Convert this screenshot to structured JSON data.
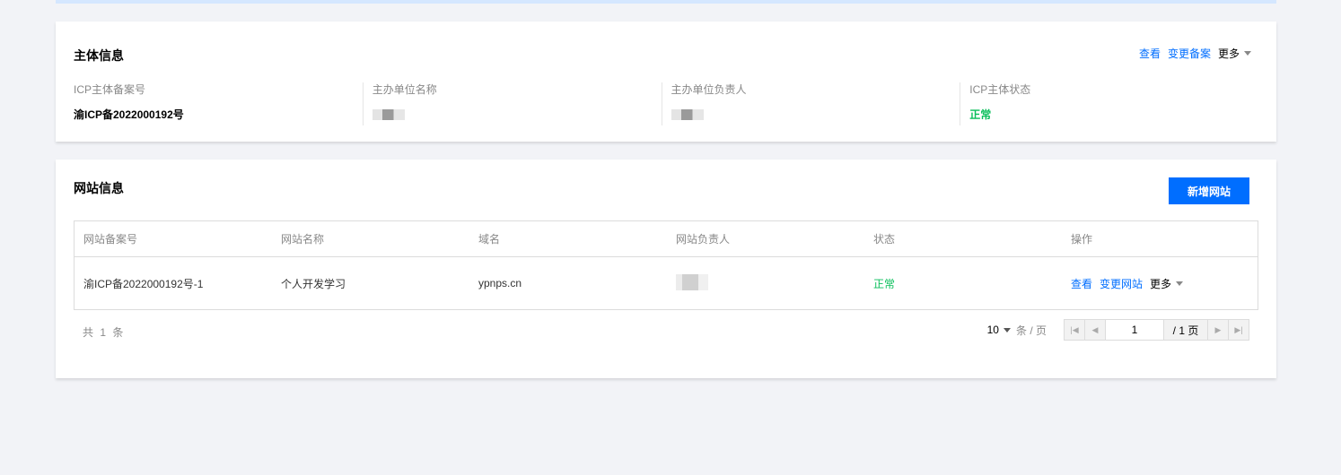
{
  "subject": {
    "title": "主体信息",
    "actions": {
      "view": "查看",
      "change": "变更备案",
      "more": "更多"
    },
    "fields": [
      {
        "label": "ICP主体备案号",
        "value": "渝ICP备2022000192号"
      },
      {
        "label": "主办单位名称",
        "value": ""
      },
      {
        "label": "主办单位负责人",
        "value": ""
      },
      {
        "label": "ICP主体状态",
        "value": "正常"
      }
    ]
  },
  "site": {
    "title": "网站信息",
    "add_button": "新增网站",
    "columns": [
      "网站备案号",
      "网站名称",
      "域名",
      "网站负责人",
      "状态",
      "操作"
    ],
    "rows": [
      {
        "record_no": "渝ICP备2022000192号-1",
        "name": "个人开发学习",
        "domain": "ypnps.cn",
        "owner": "",
        "status": "正常",
        "ops": {
          "view": "查看",
          "change": "变更网站",
          "more": "更多"
        }
      }
    ],
    "pager": {
      "total_text": "共 1 条",
      "page_size": "10",
      "page_size_unit": "条 / 页",
      "current_page": "1",
      "total_pages": "/ 1 页"
    }
  },
  "colors": {
    "accent": "#006eff",
    "success": "#0abf5b",
    "background": "#f2f3f7"
  }
}
